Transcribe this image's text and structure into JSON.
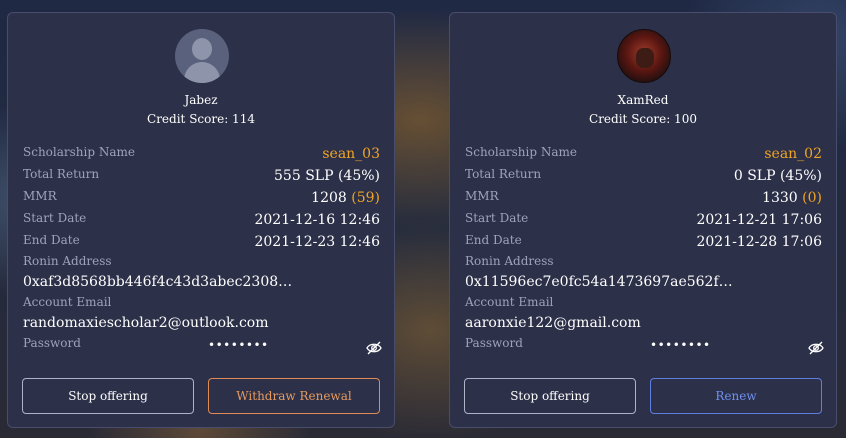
{
  "cards": [
    {
      "avatar": "default-person-avatar",
      "name": "Jabez",
      "credit_score": "Credit Score: 114",
      "scholarship_name_label": "Scholarship Name",
      "scholarship_name": "sean_03",
      "total_return_label": "Total Return",
      "total_return": "555 SLP (45%)",
      "mmr_label": "MMR",
      "mmr_value": "1208",
      "mmr_delta": "(59)",
      "start_date_label": "Start Date",
      "start_date": "2021-12-16 12:46",
      "end_date_label": "End Date",
      "end_date": "2021-12-23 12:46",
      "ronin_label": "Ronin Address",
      "ronin": "0xaf3d8568bb446f4c43d3abec2308…",
      "email_label": "Account Email",
      "email": "randomaxiescholar2@outlook.com",
      "password_label": "Password",
      "password": "••••••••",
      "eye_icon": "eye-off-icon",
      "stop_button": "Stop offering",
      "second_button": "Withdraw Renewal"
    },
    {
      "avatar": "user-photo-avatar",
      "name": "XamRed",
      "credit_score": "Credit Score: 100",
      "scholarship_name_label": "Scholarship Name",
      "scholarship_name": "sean_02",
      "total_return_label": "Total Return",
      "total_return": "0 SLP (45%)",
      "mmr_label": "MMR",
      "mmr_value": "1330",
      "mmr_delta": "(0)",
      "start_date_label": "Start Date",
      "start_date": "2021-12-21 17:06",
      "end_date_label": "End Date",
      "end_date": "2021-12-28 17:06",
      "ronin_label": "Ronin Address",
      "ronin": "0x11596ec7e0fc54a1473697ae562f…",
      "email_label": "Account Email",
      "email": "aaronxie122@gmail.com",
      "password_label": "Password",
      "password": "••••••••",
      "eye_icon": "eye-off-icon",
      "stop_button": "Stop offering",
      "second_button": "Renew"
    }
  ],
  "colors": {
    "accent": "#f0a524",
    "withdraw": "#e59a5f",
    "renew": "#6f90f0",
    "card_bg": "#2c3048",
    "label": "#9ea3bd"
  }
}
